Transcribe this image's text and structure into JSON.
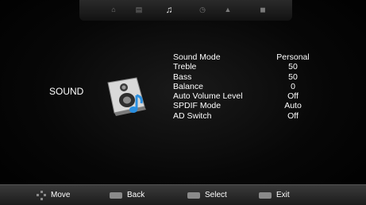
{
  "section": {
    "title": "SOUND",
    "icon": "speaker-note-icon"
  },
  "top_tabs": [
    {
      "icon": "house-icon",
      "active": false
    },
    {
      "icon": "image-icon",
      "active": false
    },
    {
      "icon": "music-note-icon",
      "active": true
    },
    {
      "icon": "clock-icon",
      "active": false
    },
    {
      "icon": "lock-icon",
      "active": false
    },
    {
      "icon": "settings-icon",
      "active": false
    }
  ],
  "menu": [
    {
      "label": "Sound Mode",
      "value": "Personal"
    },
    {
      "label": "Treble",
      "value": "50"
    },
    {
      "label": "Bass",
      "value": "50"
    },
    {
      "label": "Balance",
      "value": "0"
    },
    {
      "label": "Auto Volume Level",
      "value": "Off"
    },
    {
      "label": "SPDIF Mode",
      "value": "Auto"
    },
    {
      "label": "AD Switch",
      "value": "Off"
    }
  ],
  "footer": {
    "move": "Move",
    "back": "Back",
    "select": "Select",
    "exit": "Exit"
  }
}
